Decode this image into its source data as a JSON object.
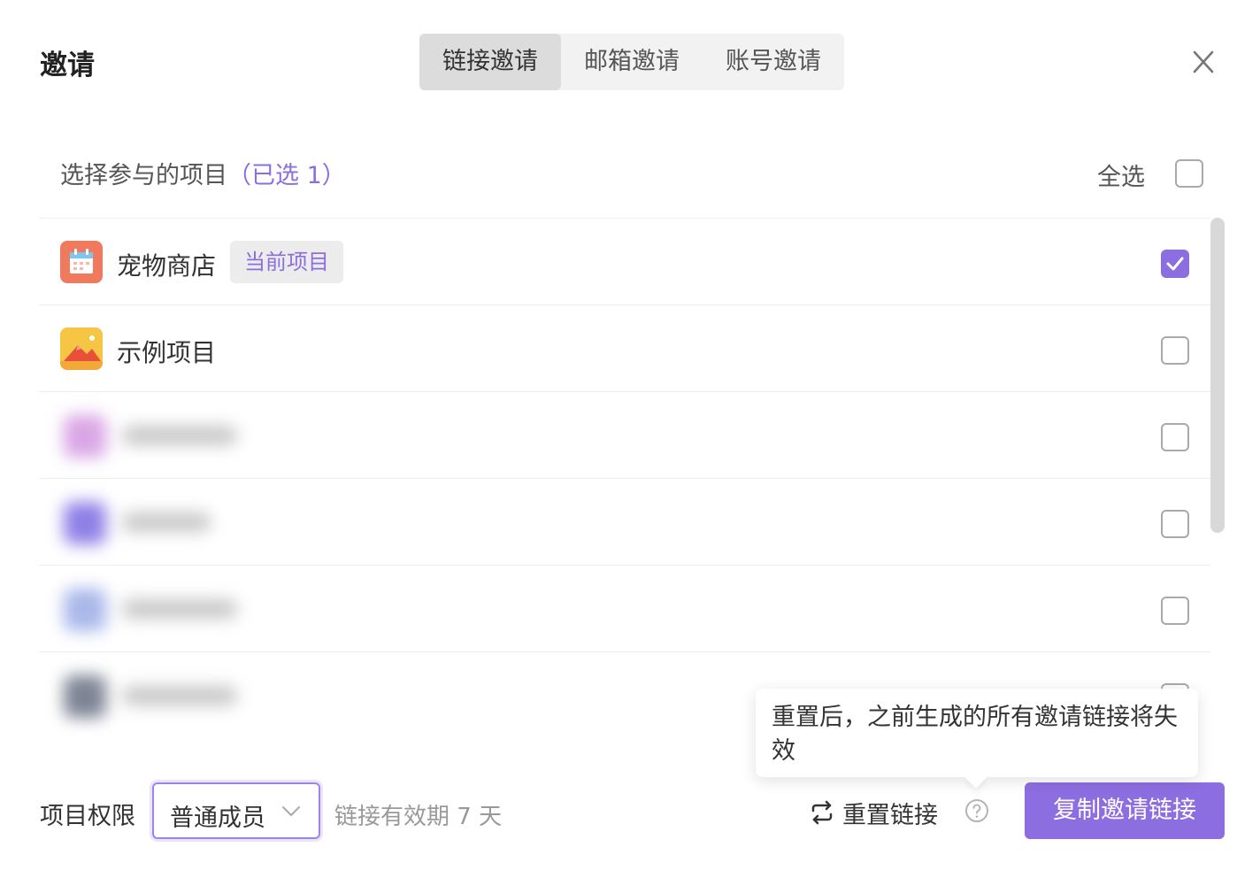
{
  "dialog": {
    "title": "邀请",
    "tabs": [
      {
        "label": "链接邀请",
        "active": true
      },
      {
        "label": "邮箱邀请",
        "active": false
      },
      {
        "label": "账号邀请",
        "active": false
      }
    ],
    "close_icon": "close-icon"
  },
  "selection": {
    "header": "选择参与的项目",
    "count_text": "（已选 1）",
    "select_all_label": "全选",
    "select_all_checked": false
  },
  "projects": [
    {
      "name": "宠物商店",
      "badge": "当前项目",
      "checked": true,
      "icon": "calendar-icon"
    },
    {
      "name": "示例项目",
      "badge": "",
      "checked": false,
      "icon": "mountain-icon"
    },
    {
      "blurred": true,
      "checked": false,
      "icon_color": "#d9a6e6"
    },
    {
      "blurred": true,
      "checked": false,
      "icon_color": "#8f80e6"
    },
    {
      "blurred": true,
      "checked": false,
      "icon_color": "#a9b8ea"
    },
    {
      "blurred": true,
      "checked": false,
      "icon_color": "#7d8494"
    }
  ],
  "footer": {
    "permission_label": "项目权限",
    "permission_value": "普通成员",
    "validity_text": "链接有效期 7 天",
    "reset_label": "重置链接",
    "copy_button": "复制邀请链接",
    "tooltip_text": "重置后，之前生成的所有邀请链接将失效"
  },
  "colors": {
    "accent": "#8d6ee0",
    "tab_bg": "#f2f2f2",
    "tab_active_bg": "#dcdcdc"
  }
}
